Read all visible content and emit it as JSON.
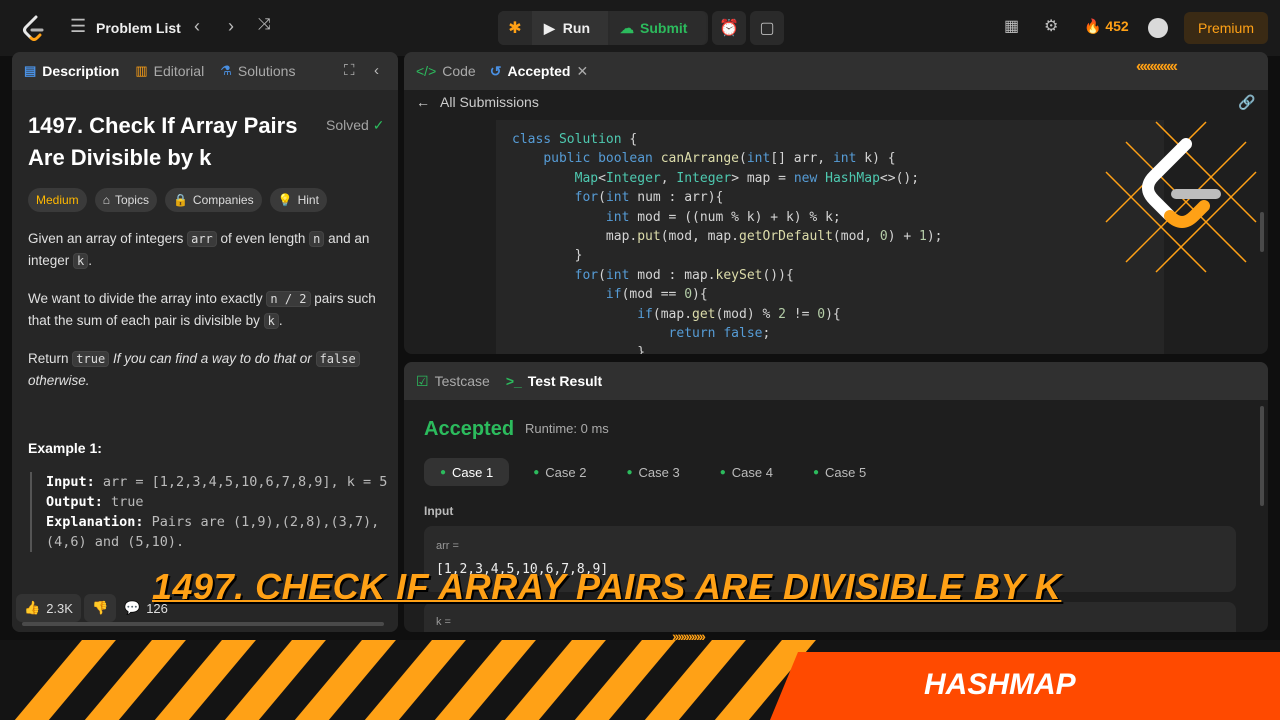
{
  "header": {
    "problem_list": "Problem List",
    "run": "Run",
    "submit": "Submit",
    "streak": "452",
    "premium": "Premium"
  },
  "left": {
    "tabs": [
      "Description",
      "Editorial",
      "Solutions"
    ],
    "title": "1497. Check If Array Pairs Are Divisible by k",
    "solved": "Solved",
    "tags": [
      "Medium",
      "Topics",
      "Companies",
      "Hint"
    ],
    "desc": {
      "p1a": "Given an array of integers ",
      "p1code1": "arr",
      "p1b": " of even length ",
      "p1code2": "n",
      "p1c": " and an integer ",
      "p1code3": "k",
      "p1d": ".",
      "p2a": "We want to divide the array into exactly ",
      "p2code": "n / 2",
      "p2b": " pairs such that the sum of each pair is divisible by ",
      "p2code2": "k",
      "p2c": ".",
      "p3a": "Return ",
      "p3code1": "true",
      "p3b": " If you can find a way to do that or ",
      "p3code2": "false",
      "p3c": " otherwise."
    },
    "example_title": "Example 1:",
    "example": {
      "input_label": "Input:",
      "input": " arr = [1,2,3,4,5,10,6,7,8,9], k = 5",
      "output_label": "Output:",
      "output": " true",
      "expl_label": "Explanation:",
      "expl": " Pairs are (1,9),(2,8),(3,7),(4,6) and (5,10)."
    },
    "likes": "2.3K",
    "comments": "126"
  },
  "code": {
    "tabs": [
      "Code",
      "Accepted"
    ],
    "all_submissions": "All Submissions"
  },
  "result": {
    "tabs": [
      "Testcase",
      "Test Result"
    ],
    "status": "Accepted",
    "runtime": "Runtime: 0 ms",
    "cases": [
      "Case 1",
      "Case 2",
      "Case 3",
      "Case 4",
      "Case 5"
    ],
    "input_label": "Input",
    "arr_key": "arr =",
    "arr_val": "[1,2,3,4,5,10,6,7,8,9]",
    "k_key": "k ="
  },
  "overlay": {
    "title": "1497. CHECK IF ARRAY PAIRS ARE DIVISIBLE BY K",
    "tag": "HASHMAP"
  },
  "colors": {
    "accent": "#ffa116",
    "success": "#2cbb5d",
    "highlight": "#ff4a00"
  }
}
